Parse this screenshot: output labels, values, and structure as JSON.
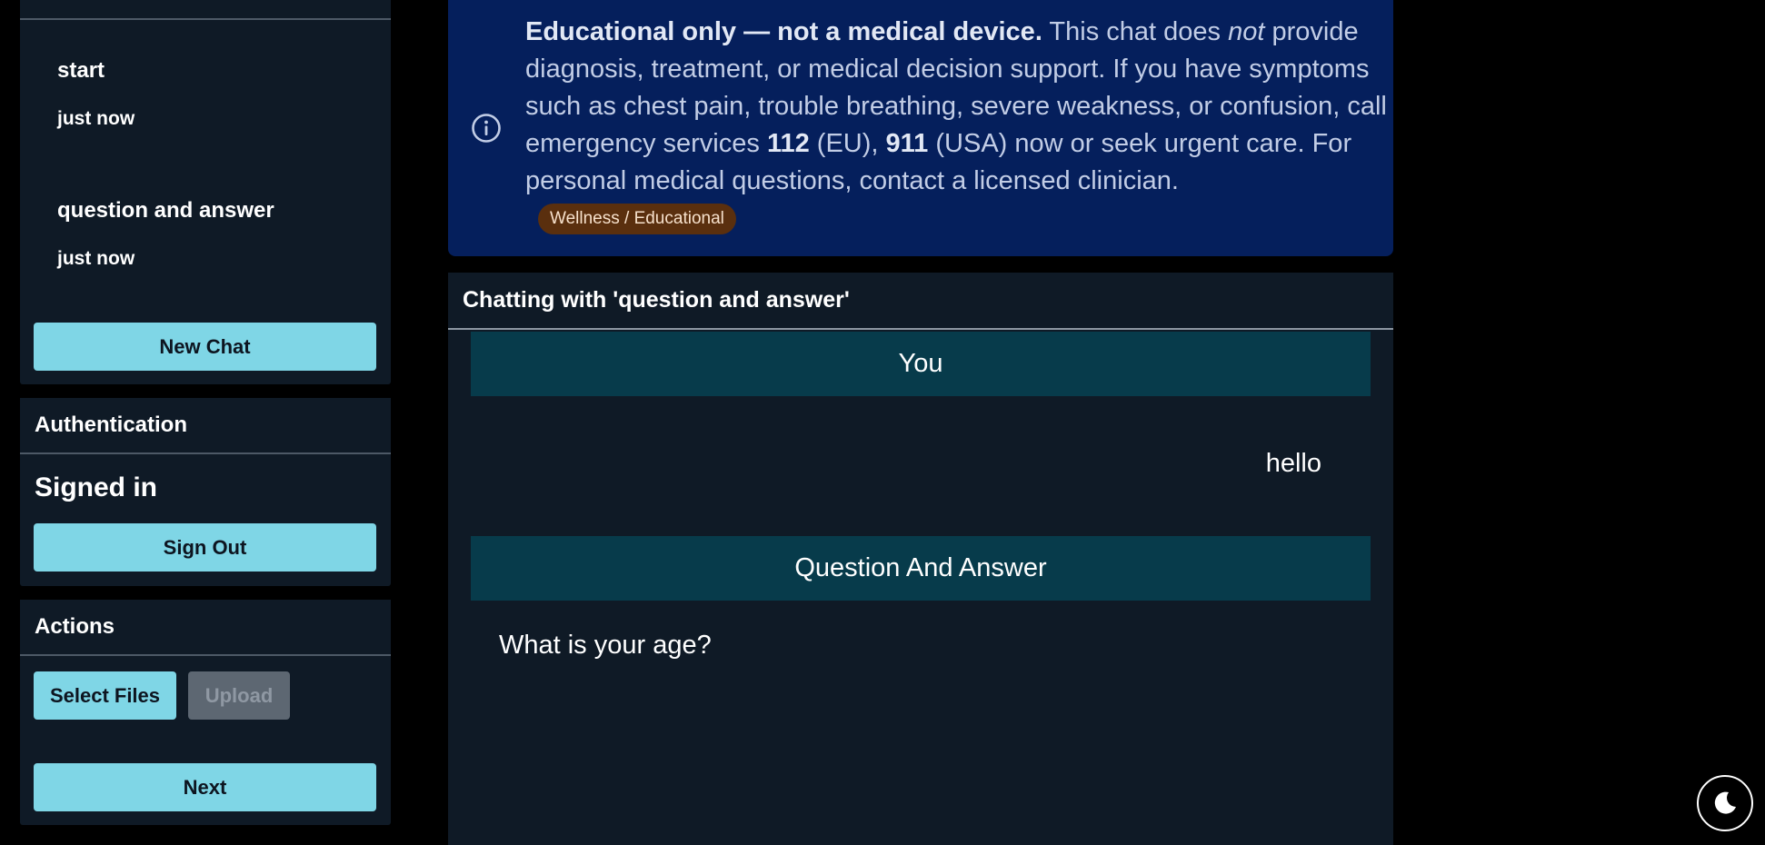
{
  "sidebar": {
    "chats": [
      {
        "title": "start",
        "time": "just now"
      },
      {
        "title": "question and answer",
        "time": "just now"
      }
    ],
    "new_chat_label": "New Chat",
    "auth": {
      "header": "Authentication",
      "status": "Signed in",
      "sign_out_label": "Sign Out"
    },
    "actions": {
      "header": "Actions",
      "select_files_label": "Select Files",
      "upload_label": "Upload",
      "next_label": "Next"
    }
  },
  "disclaimer": {
    "icon": "info-icon",
    "lead_bold": "Educational only — not a medical device.",
    "text_1": " This chat does ",
    "emphasis": "not",
    "text_2": " provide diagnosis, treatment, or medical decision support. If you have symptoms such as chest pain, trouble breathing, severe weakness, or confusion, call emergency services ",
    "num_eu": "112",
    "text_3": " (EU), ",
    "num_us": "911",
    "text_4": " (USA) now or seek urgent care. For personal medical questions, contact a licensed clinician.",
    "badge": "Wellness / Educational"
  },
  "chat": {
    "header": "Chatting with 'question and answer'",
    "messages": [
      {
        "speaker": "You",
        "text": "hello"
      },
      {
        "speaker": "Question And Answer",
        "text": "What is your age?"
      }
    ]
  },
  "theme_toggle": {
    "icon": "moon-icon"
  }
}
